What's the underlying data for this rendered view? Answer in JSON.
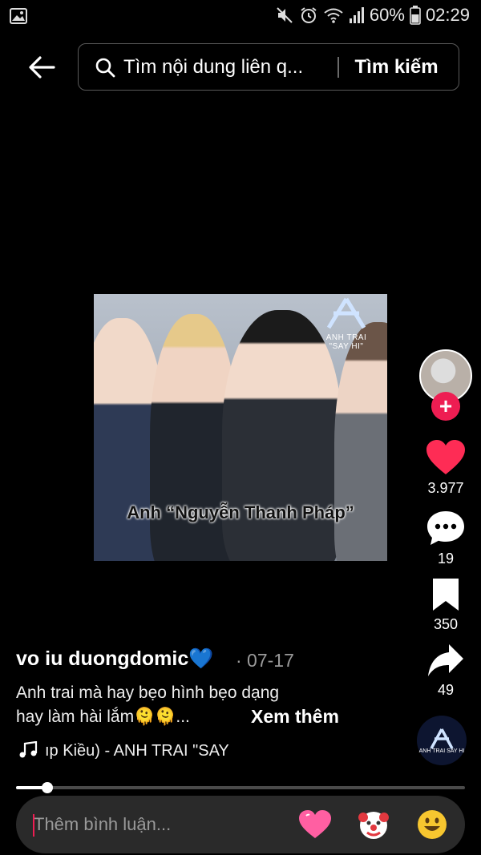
{
  "status_bar": {
    "battery": "60%",
    "time": "02:29"
  },
  "header": {
    "search_placeholder": "Tìm nội dung liên q...",
    "search_button": "Tìm kiếm"
  },
  "video": {
    "caption_overlay": "Anh “Nguyễn Thanh Pháp”",
    "brand_text": "ANH TRAI \"SAY HI\""
  },
  "rail": {
    "likes": "3.977",
    "comments": "19",
    "saves": "350",
    "shares": "49"
  },
  "post": {
    "username": "vo iu duongdomic💙",
    "date": "· 07-17",
    "description_line1": "Anh trai mà hay bẹo hình bẹo dạng",
    "description_line2": "hay làm hài lắm🫠🫠...",
    "see_more": "Xem thêm",
    "music": "ıp Kiều) - ANH TRAI \"SAY",
    "disc_text": "ANH TRAI SAY HI"
  },
  "playback": {
    "progress_fraction": 0.07
  },
  "comment_bar": {
    "placeholder": "Thêm bình luận...",
    "emojis": [
      "💗",
      "🤡",
      "😃"
    ]
  },
  "colors": {
    "accent": "#ee1d52",
    "heart": "#fe2c55"
  }
}
